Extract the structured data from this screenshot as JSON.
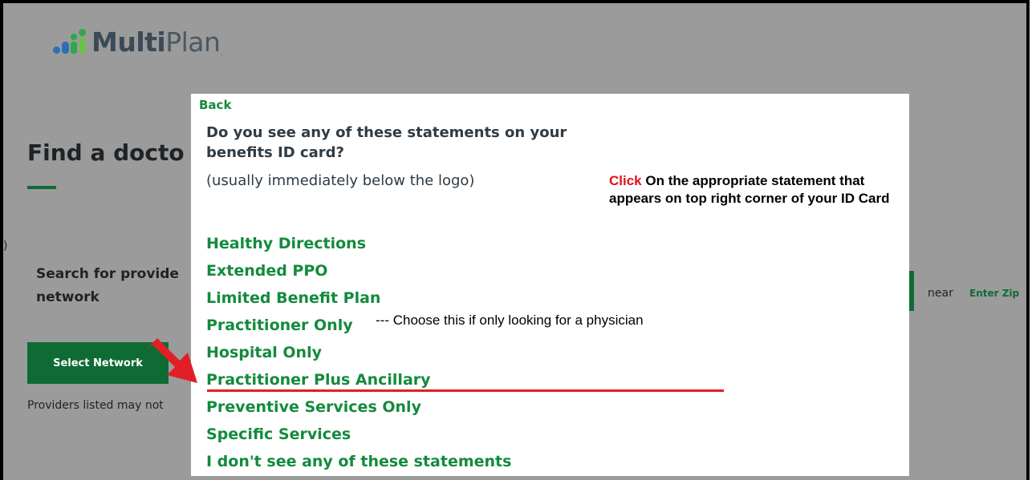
{
  "logo": {
    "brand_bold": "Multi",
    "brand_light": "Plan",
    "registered": "."
  },
  "background": {
    "title": "Find a docto",
    "search_line1": "Search for provide",
    "search_line2": "network",
    "select_button": "Select Network",
    "providers_note": "Providers listed may not",
    "near_label": "near",
    "enter_zip": "Enter Zip"
  },
  "modal": {
    "back_label": "Back",
    "question": "Do you see any of these statements on your benefits ID card?",
    "hint": "(usually immediately below the logo)",
    "instruction_click": "Click",
    "instruction_rest": " On the appropriate statement that appears on top right corner of your ID Card",
    "options": [
      "Healthy Directions",
      "Extended PPO",
      "Limited Benefit Plan",
      "Practitioner Only",
      "Hospital Only",
      "Practitioner Plus Ancillary",
      "Preventive Services Only",
      "Specific Services",
      "I don't see any of these statements"
    ],
    "practitioner_note": "--- Choose this if only looking for a physician"
  },
  "colors": {
    "accent_green": "#138b3c",
    "dark_green": "#0f6b34",
    "annotation_red": "#e21f26",
    "overlay_gray": "#9b9b9b"
  }
}
